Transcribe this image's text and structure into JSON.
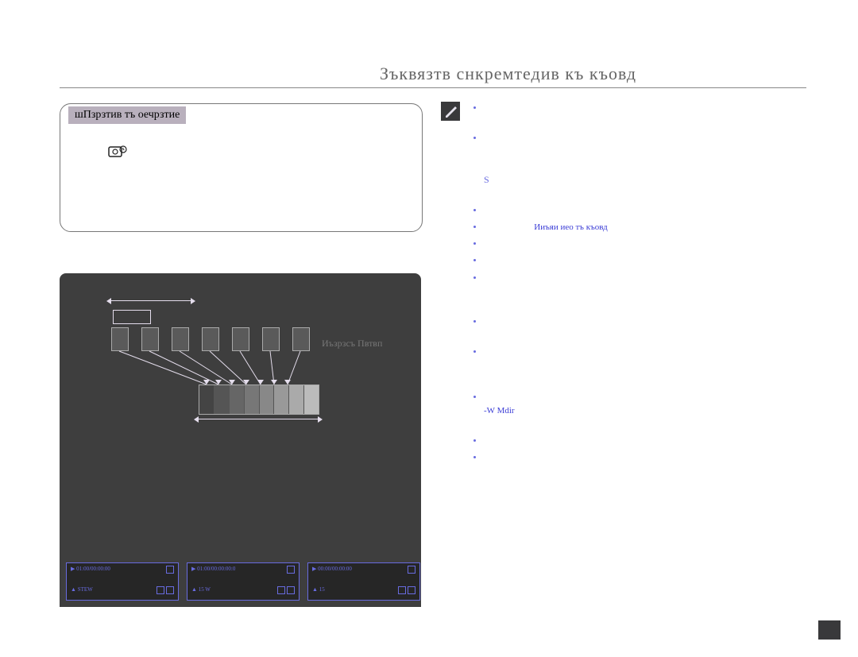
{
  "doc_title": "Зъквязтв снкремтедив къ къовд",
  "box": {
    "title": "шПзрзтив тъ оечрзтие"
  },
  "heading1": "",
  "diagram": {
    "top_label": "",
    "small_label": "",
    "right_label": "Иъзрзсъ Пвтвп",
    "right_block": [
      "",
      "",
      ""
    ]
  },
  "bullets": [
    "",
    "",
    "",
    "",
    "",
    "",
    "",
    ""
  ],
  "thumbs": [
    {
      "topleft": "01:00/00:00:00",
      "topright": "",
      "botleft": "STEW",
      "botright": ""
    },
    {
      "topleft": "01:00/00:00:00:0",
      "topright": "",
      "botleft": "15 W",
      "botright": ""
    },
    {
      "topleft": "00:00/00:00:00",
      "topright": "",
      "botleft": "15",
      "botright": ""
    }
  ],
  "notes": [
    "Ииъяи  иео тъ къовд"
  ],
  "note_bold": "-W Mdir",
  "pagenum": ""
}
